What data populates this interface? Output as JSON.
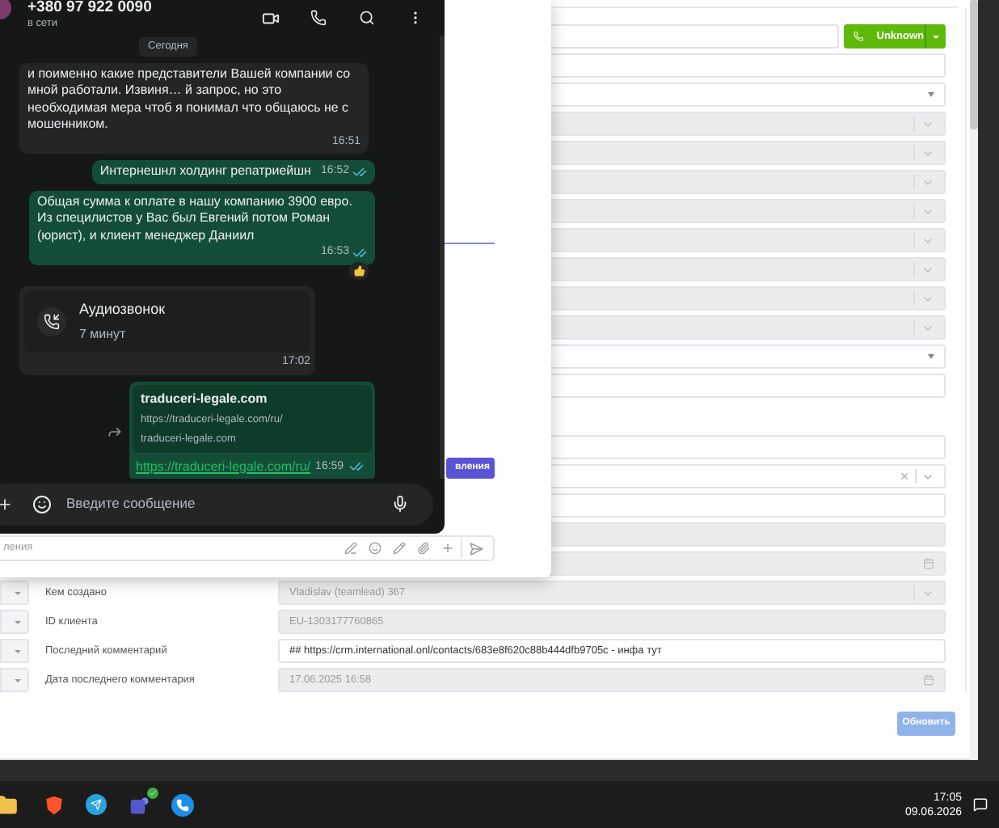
{
  "chat_window": {
    "contact": "+380 97 922 0090",
    "presence": "в сети",
    "date_divider": "Сегодня",
    "messages": [
      {
        "kind": "text",
        "outgoing": false,
        "text": "и поименно какие представители Вашей компании со мной работали. Извиня… й запрос, но это необходимая мера чтоб я понимал что общаюсь не с мошенником.",
        "time": "16:51"
      },
      {
        "kind": "text",
        "outgoing": true,
        "text": "Интернешнл холдинг репатриейшн",
        "time": "16:52",
        "read": true
      },
      {
        "kind": "text",
        "outgoing": true,
        "text": "Общая сумма к оплате в нашу компанию 3900 евро. Из специлистов у Вас был Евгений потом Роман (юрист), и клиент менеджер Даниил",
        "time": "16:53",
        "read": true,
        "reacted": true
      },
      {
        "kind": "call",
        "outgoing": false,
        "title": "Аудиозвонок",
        "duration": "7 минут",
        "time": "17:02"
      },
      {
        "kind": "link",
        "outgoing": true,
        "preview_title": "traduceri-legale.com",
        "preview_url": "https://traduceri-legale.com/ru/",
        "preview_domain": "traduceri-legale.com",
        "link": "https://traduceri-legale.com/ru/",
        "time": "16:59",
        "read": true
      }
    ],
    "composer": {
      "placeholder": "Введите сообщение"
    }
  },
  "side_panel": {
    "action_button": "вления",
    "composer_text": "ления"
  },
  "form": {
    "call_button": "Unknown",
    "fields": [
      {
        "kind": "input",
        "disabled": false
      },
      {
        "kind": "select",
        "disabled": false
      },
      {
        "kind": "select",
        "disabled": true
      },
      {
        "kind": "select",
        "disabled": true
      },
      {
        "kind": "select",
        "disabled": true
      },
      {
        "kind": "select",
        "disabled": true
      },
      {
        "kind": "select",
        "disabled": true
      },
      {
        "kind": "select",
        "disabled": true
      },
      {
        "kind": "select",
        "disabled": true
      },
      {
        "kind": "select",
        "disabled": true
      },
      {
        "kind": "select",
        "disabled": false
      },
      {
        "kind": "input",
        "disabled": false
      }
    ],
    "fields_lower": [
      {
        "kind": "input",
        "disabled": false
      },
      {
        "kind": "clearable",
        "disabled": false
      },
      {
        "kind": "input",
        "disabled": false
      },
      {
        "kind": "input",
        "disabled": true
      },
      {
        "kind": "date",
        "disabled": true
      }
    ],
    "rows": [
      {
        "label": "Кем создано",
        "kind": "select",
        "disabled": true,
        "value": "Vladislav (teamlead) 367"
      },
      {
        "label": "ID клиента",
        "kind": "input",
        "disabled": true,
        "value": "EU-1303177760865"
      },
      {
        "label": "Последний комментарий",
        "kind": "input",
        "disabled": false,
        "value": "## https://crm.international.onl/contacts/683e8f620c88b444dfb9705c - инфа тут"
      },
      {
        "label": "Дата последнего комментария",
        "kind": "date",
        "disabled": true,
        "value": "17.06.2025 16:58"
      }
    ],
    "submit": "Обновить"
  },
  "taskbar": {
    "time": "17:05",
    "date": "09.06.2026"
  }
}
